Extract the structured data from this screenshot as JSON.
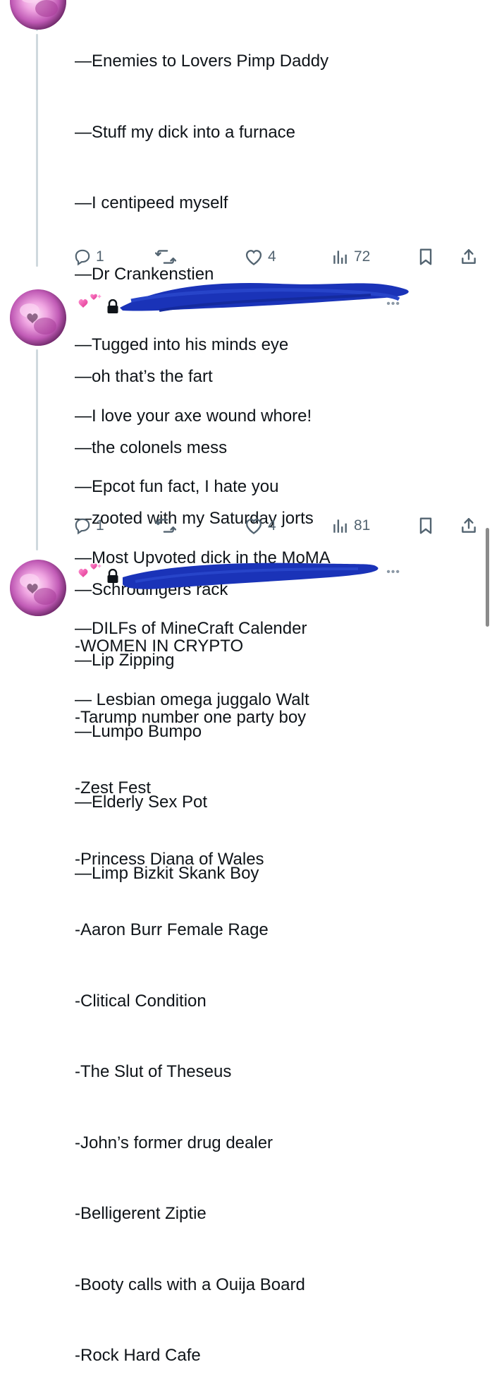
{
  "theme": {
    "text_color": "#0f1419",
    "action_color": "#536471",
    "redaction_color": "#1a33b8",
    "thread_line_color": "#cfd9de"
  },
  "reply1": {
    "lines": [
      "—Enemies to Lovers Pimp Daddy",
      "—Stuff my dick into a furnace",
      "—I centipeed myself",
      "—Dr Crankenstien",
      "—Tugged into his minds eye",
      "—I love your axe wound whore!",
      "—Epcot fun fact, I hate you",
      "—Most Upvoted dick in the MoMA",
      "—DILFs of MineCraft Calender",
      "— Lesbian omega juggalo Walt"
    ],
    "actions": {
      "replies": "1",
      "likes": "4",
      "views": "72"
    }
  },
  "reply2": {
    "header_icons": [
      "sparkling-heart-emoji",
      "lock-icon"
    ],
    "lines": [
      "—oh that’s the fart",
      "—the colonels mess",
      "—zooted with my Saturday jorts",
      "—Schrödingers rack",
      "—Lip Zipping",
      "—Lumpo Bumpo",
      "—Elderly Sex Pot",
      "—Limp Bizkit Skank Boy"
    ],
    "actions": {
      "replies": "1",
      "likes": "4",
      "views": "81"
    }
  },
  "reply3": {
    "header_icons": [
      "sparkling-heart-emoji",
      "lock-icon"
    ],
    "lines": [
      "-WOMEN IN CRYPTO",
      "-Tarump number one party boy",
      "-Zest Fest",
      "-Princess Diana of Wales",
      "-Aaron Burr Female Rage",
      "-Clitical Condition",
      "-The Slut of Theseus",
      "-John’s former drug dealer",
      "-Belligerent Ziptie",
      "-Booty calls with a Ouija Board",
      "-Rock Hard Cafe"
    ]
  },
  "more_label": "•••"
}
